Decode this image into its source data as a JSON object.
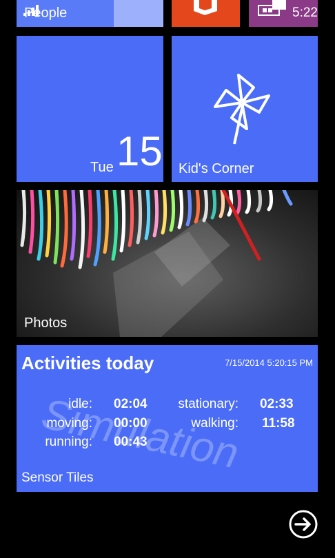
{
  "top_row": {
    "people_label": "People",
    "clock": "5:22"
  },
  "calendar": {
    "day": "Tue",
    "date": "15"
  },
  "kids_corner": {
    "label": "Kid's Corner"
  },
  "photos": {
    "label": "Photos"
  },
  "activities": {
    "title": "Activities today",
    "timestamp": "7/15/2014 5:20:15 PM",
    "watermark": "Simulation",
    "footer": "Sensor Tiles",
    "stats": {
      "idle_label": "idle:",
      "idle_value": "02:04",
      "stationary_label": "stationary:",
      "stationary_value": "02:33",
      "moving_label": "moving:",
      "moving_value": "00:00",
      "walking_label": "walking:",
      "walking_value": "11:58",
      "running_label": "running:",
      "running_value": "00:43"
    }
  },
  "colors": {
    "tile_blue": "#4a6cf7",
    "office_orange": "#e5471c",
    "store_purple": "#8b3a87",
    "background": "#000000"
  },
  "icons": {
    "office": "office-icon",
    "store": "store-icon",
    "kids_corner": "pinwheel-icon",
    "next": "arrow-right-circle-icon",
    "signal": "signal-strength-icon"
  }
}
